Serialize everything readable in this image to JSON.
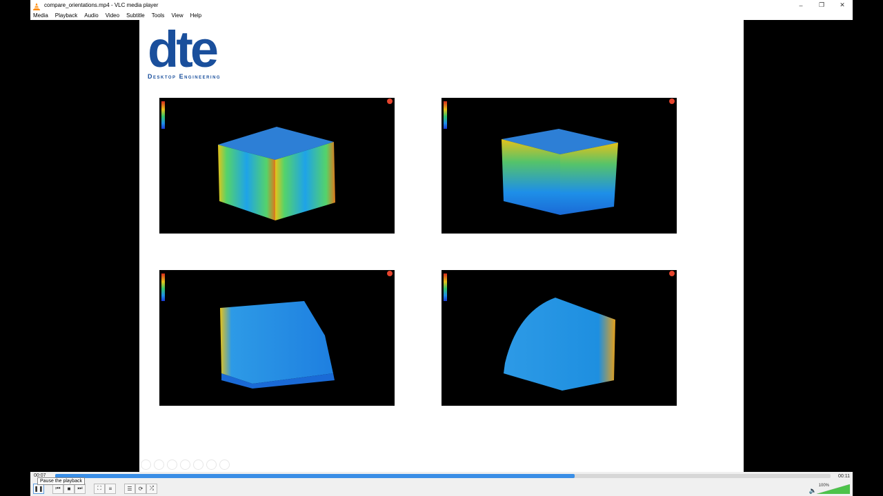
{
  "window": {
    "title": "compare_orientations.mp4 - VLC media player",
    "icon": "vlc-cone-icon",
    "controls": [
      "minimize-icon",
      "restore-icon",
      "close-icon"
    ]
  },
  "menu": [
    "Media",
    "Playback",
    "Audio",
    "Video",
    "Subtitle",
    "Tools",
    "View",
    "Help"
  ],
  "slide": {
    "logo_text": "dte",
    "logo_subtitle": "Desktop Engineering",
    "brand_color": "#1a4f9c",
    "panels": [
      "simulation-render-1",
      "simulation-render-2",
      "simulation-render-3",
      "simulation-render-4"
    ]
  },
  "player": {
    "current_time": "00:07",
    "total_time": "00:11",
    "progress": 0.67,
    "tooltip": "Pause the playback",
    "volume": "100%",
    "accent_color": "#3a8ee6",
    "buttons": [
      "pause-icon",
      "previous-icon",
      "stop-icon",
      "next-icon",
      "fullscreen-icon",
      "extended-settings-icon",
      "playlist-icon",
      "loop-icon",
      "shuffle-icon"
    ]
  }
}
